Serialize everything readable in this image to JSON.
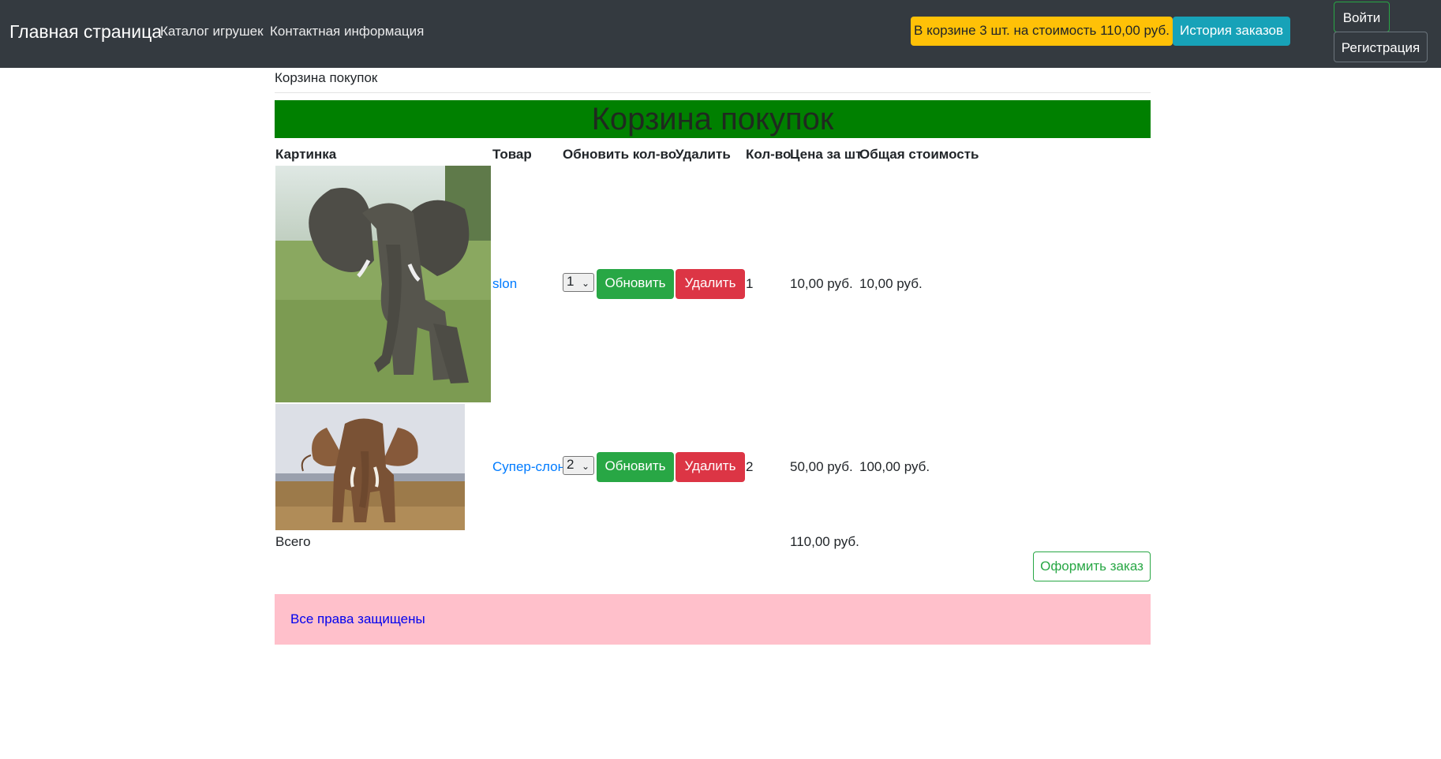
{
  "navbar": {
    "brand": "Главная страница",
    "links": [
      "Каталог игрушек",
      "Контактная информация"
    ],
    "cart_badge": "В корзине 3 шт. на стоимость 110,00 руб.",
    "history_button": "История заказов",
    "login_button": "Войти",
    "register_button": "Регистрация"
  },
  "breadcrumb": "Корзина покупок",
  "banner_title": "Корзина покупок",
  "table": {
    "headers": [
      "Картинка",
      "Товар",
      "Обновить кол-во",
      "Удалить",
      "Кол-во",
      "Цена за шт",
      "Общая стоимость"
    ],
    "rows": [
      {
        "name": "slon",
        "select_value": "1",
        "update_label": "Обновить",
        "delete_label": "Удалить",
        "qty": "1",
        "price": "10,00 руб.",
        "total": "10,00 руб."
      },
      {
        "name": "Супер-слон",
        "select_value": "2",
        "update_label": "Обновить",
        "delete_label": "Удалить",
        "qty": "2",
        "price": "50,00 руб.",
        "total": "100,00 руб."
      }
    ],
    "total_label": "Всего",
    "total_value": "110,00 руб."
  },
  "checkout_button": "Оформить заказ",
  "footer_text": "Все права защищены",
  "colors": {
    "navbar": "#343a40",
    "banner": "#008000",
    "footer": "#ffc0cb",
    "warning": "#ffc107",
    "info": "#17a2b8",
    "success": "#28a745",
    "danger": "#dc3545",
    "link": "#007bff"
  }
}
